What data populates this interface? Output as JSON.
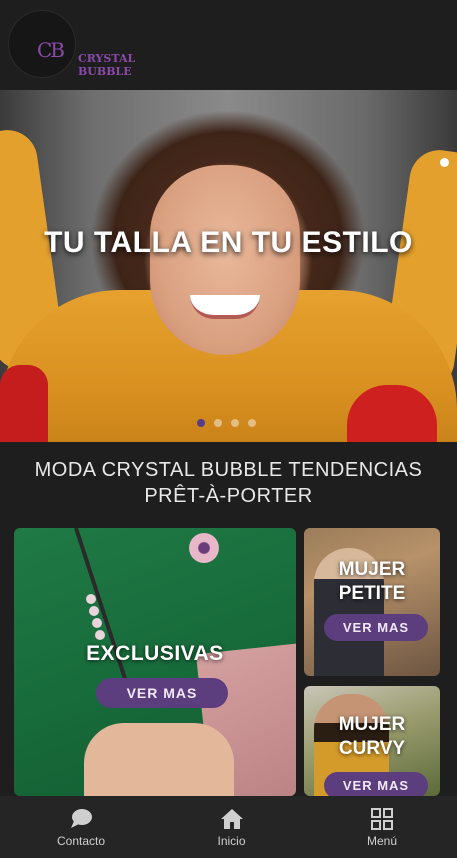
{
  "brand": {
    "mark": "CB",
    "line1": "CRYSTAL",
    "line2": "BUBBLE",
    "color": "#8a4aa8"
  },
  "hero": {
    "title": "TU TALLA EN TU ESTILO",
    "slides": 4,
    "active_slide": 1
  },
  "section": {
    "title_line1": "MODA CRYSTAL BUBBLE TENDENCIAS",
    "title_line2": "PRÊT-À-PORTER"
  },
  "cards": {
    "exclusivas": {
      "label": "EXCLUSIVAS",
      "button": "VER MAS"
    },
    "petite": {
      "label_line1": "MUJER",
      "label_line2": "PETITE",
      "button": "VER MAS"
    },
    "curvy": {
      "label_line1": "MUJER",
      "label_line2": "CURVY",
      "button": "VER MAS"
    }
  },
  "accent_color": "#5c3d7d",
  "bottom_nav": {
    "contacto": {
      "label": "Contacto",
      "icon": "chat-bubble-icon"
    },
    "inicio": {
      "label": "Inicio",
      "icon": "home-icon"
    },
    "menu": {
      "label": "Menú",
      "icon": "grid-icon"
    }
  }
}
